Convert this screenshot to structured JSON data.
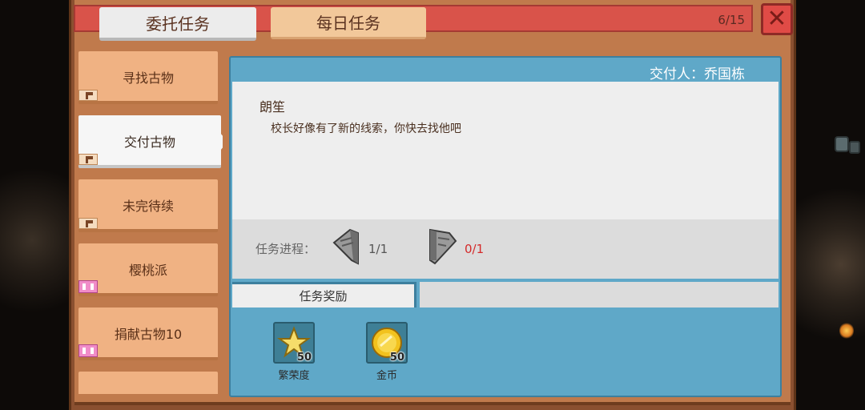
{
  "tabs": {
    "commission": "委托任务",
    "daily": "每日任务"
  },
  "counter": "6/15",
  "close_icon": "close-icon",
  "quests": [
    {
      "label": "寻找古物",
      "tag": "flag-icon"
    },
    {
      "label": "交付古物",
      "tag": "flag-icon",
      "active": true
    },
    {
      "label": "未完待续",
      "tag": "flag-icon"
    },
    {
      "label": "樱桃派",
      "tag": "building-icon"
    },
    {
      "label": "捐献古物10",
      "tag": "building-icon"
    },
    {
      "label": "",
      "tag": ""
    }
  ],
  "detail": {
    "giver": "交付人：乔国栋",
    "npc_name": "朗笙",
    "message": "校长好像有了新的线索，你快去找他吧",
    "progress_label": "任务进程：",
    "progress": [
      {
        "icon": "stone-tablet-icon",
        "text": "1/1",
        "color": "#555555"
      },
      {
        "icon": "stone-shard-icon",
        "text": "0/1",
        "color": "#d42a2a"
      }
    ],
    "reward_tab": "任务奖励",
    "rewards": [
      {
        "icon": "star-icon",
        "qty": "50",
        "name": "繁荣度"
      },
      {
        "icon": "gold-coin-icon",
        "qty": "50",
        "name": "金币"
      }
    ]
  }
}
